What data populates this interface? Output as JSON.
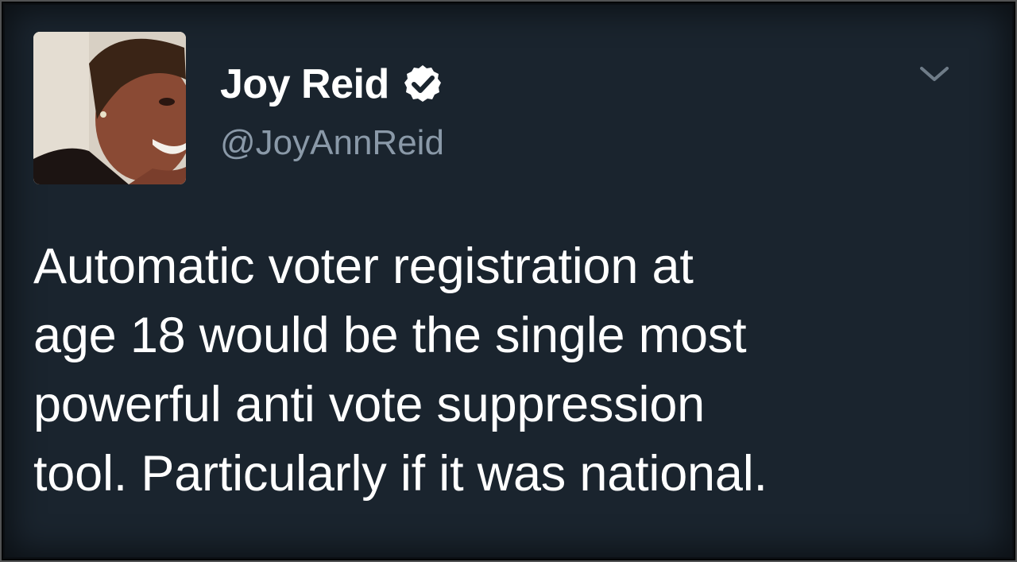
{
  "tweet": {
    "author": {
      "display_name": "Joy Reid",
      "handle": "@JoyAnnReid",
      "verified": true
    },
    "text": "Automatic voter registration at\nage 18 would be the single most\npowerful anti vote suppression\ntool. Particularly if it was national.",
    "menu_icon": "chevron-down-icon"
  },
  "colors": {
    "background": "#1a242e",
    "text": "#ffffff",
    "handle": "#8a99a8",
    "badge": "#ffffff"
  }
}
